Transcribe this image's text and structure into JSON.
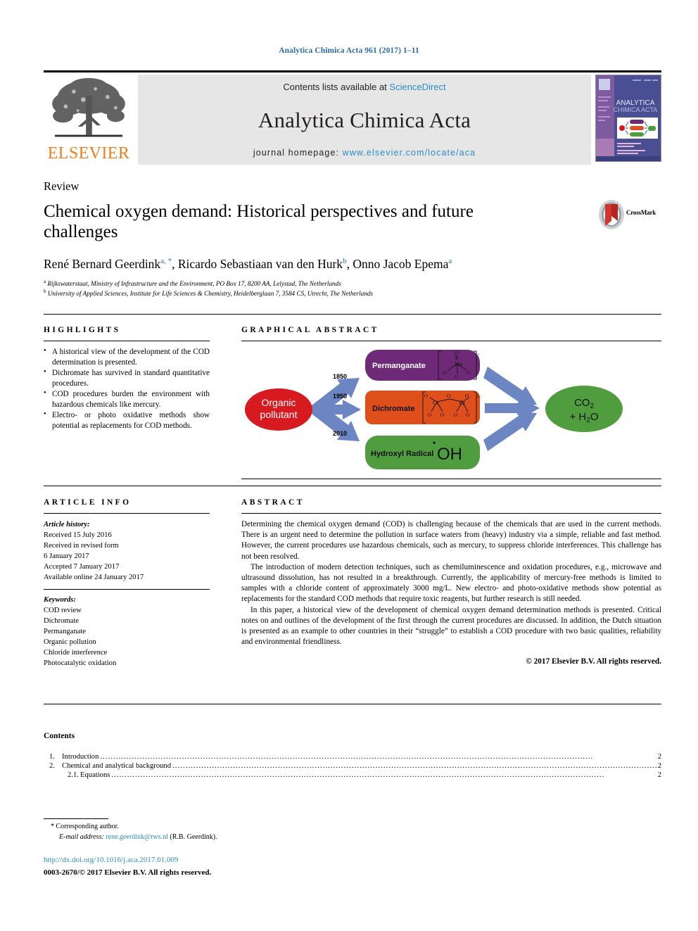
{
  "running_head": "Analytica Chimica Acta 961 (2017) 1–11",
  "masthead": {
    "contents_prefix": "Contents lists available at ",
    "contents_link": "ScienceDirect",
    "journal_title": "Analytica Chimica Acta",
    "homepage_prefix": "journal homepage: ",
    "homepage_url": "www.elsevier.com/locate/aca",
    "publisher": "ELSEVIER",
    "cover_title_line1": "ANALYTICA",
    "cover_title_line2": "CHIMICA ACTA"
  },
  "article": {
    "doctype": "Review",
    "title": "Chemical oxygen demand: Historical perspectives and future challenges",
    "crossmark_label": "CrossMark",
    "authors": [
      {
        "name": "René Bernard Geerdink",
        "marks": "a, *"
      },
      {
        "name": "Ricardo Sebastiaan van den Hurk",
        "marks": "b"
      },
      {
        "name": "Onno Jacob Epema",
        "marks": "a"
      }
    ],
    "affiliations": [
      {
        "mark": "a",
        "text": "Rijkswaterstaat, Ministry of Infrastructure and the Environment, PO Box 17, 8200 AA, Lelystad, The Netherlands"
      },
      {
        "mark": "b",
        "text": "University of Applied Sciences, Institute for Life Sciences & Chemistry, Heidelberglaan 7, 3584 CS, Utrecht, The Netherlands"
      }
    ]
  },
  "highlights": {
    "heading": "HIGHLIGHTS",
    "items": [
      "A historical view of the development of the COD determination is presented.",
      "Dichromate has survived in standard quantitative procedures.",
      "COD procedures burden the environment with hazardous chemicals like mercury.",
      "Electro- or photo oxidative methods show potential as replacements for COD methods."
    ]
  },
  "graphical_abstract": {
    "heading": "GRAPHICAL ABSTRACT",
    "source_label": "Organic pollutant",
    "product_label_1": "CO₂",
    "product_label_2": "+ H₂O",
    "steps": [
      {
        "year": "1850",
        "label": "Permanganate",
        "color": "#6e2a77"
      },
      {
        "year": "1950",
        "label": "Dichromate",
        "color": "#de4f1b"
      },
      {
        "year": "2010",
        "label": "Hydroxyl Radical",
        "formula": "•OH",
        "color": "#4f9d3f"
      }
    ],
    "colors": {
      "source": "#d71920",
      "product": "#4f9d3f",
      "arrow": "#6c86c4"
    }
  },
  "article_info": {
    "heading": "ARTICLE INFO",
    "history_label": "Article history:",
    "history": [
      "Received 15 July 2016",
      "Received in revised form",
      "6 January 2017",
      "Accepted 7 January 2017",
      "Available online 24 January 2017"
    ],
    "keywords_label": "Keywords:",
    "keywords": [
      "COD review",
      "Dichromate",
      "Permanganate",
      "Organic pollution",
      "Chloride interference",
      "Photocatalytic oxidation"
    ]
  },
  "abstract": {
    "heading": "ABSTRACT",
    "paragraphs": [
      "Determining the chemical oxygen demand (COD) is challenging because of the chemicals that are used in the current methods. There is an urgent need to determine the pollution in surface waters from (heavy) industry via a simple, reliable and fast method. However, the current procedures use hazardous chemicals, such as mercury, to suppress chloride interferences. This challenge has not been resolved.",
      "The introduction of modern detection techniques, such as chemiluminescence and oxidation procedures, e.g., microwave and ultrasound dissolution, has not resulted in a breakthrough. Currently, the applicability of mercury-free methods is limited to samples with a chloride content of approximately 3000 mg/L. New electro- and photo-oxidative methods show potential as replacements for the standard COD methods that require toxic reagents, but further research is still needed.",
      "In this paper, a historical view of the development of chemical oxygen demand determination methods is presented. Critical notes on and outlines of the development of the first through the current procedures are discussed. In addition, the Dutch situation is presented as an example to other countries in their “struggle” to establish a COD procedure with two basic qualities, reliability and environmental friendliness."
    ],
    "copyright": "© 2017 Elsevier B.V. All rights reserved."
  },
  "contents": {
    "heading": "Contents",
    "entries": [
      {
        "num": "1.",
        "label": "Introduction",
        "page": "2",
        "sub": false
      },
      {
        "num": "2.",
        "label": "Chemical and analytical background",
        "page": "2",
        "sub": false
      },
      {
        "num": "2.1.",
        "label": "Equations",
        "page": "2",
        "sub": true
      }
    ]
  },
  "footer": {
    "corresponding_star": "*",
    "corresponding_author": "Corresponding author.",
    "email_label": "E-mail address:",
    "email": "rene.geerdink@rws.nl",
    "email_owner": "(R.B. Geerdink).",
    "doi": "http://dx.doi.org/10.1016/j.aca.2017.01.009",
    "issn_line": "0003-2670/© 2017 Elsevier B.V. All rights reserved."
  }
}
